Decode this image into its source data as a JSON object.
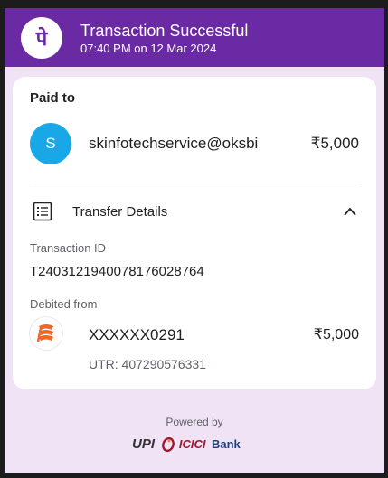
{
  "header": {
    "title": "Transaction Successful",
    "datetime": "07:40 PM on 12 Mar 2024",
    "logo_icon": "phonepe-logo-icon",
    "background": "#6a2aa3"
  },
  "payment": {
    "paid_to_label": "Paid to",
    "avatar_initial": "S",
    "avatar_color": "#18a8e8",
    "payee": "skinfotechservice@oksbi",
    "amount": "₹5,000"
  },
  "transfer_details": {
    "label": "Transfer Details",
    "icon": "list-icon",
    "toggle_icon": "chevron-up-icon",
    "transaction_id_label": "Transaction ID",
    "transaction_id": "T2403121940078176028764",
    "debited_from_label": "Debited from",
    "bank_icon": "bank-of-baroda-icon",
    "account": "XXXXXX0291",
    "amount": "₹5,000",
    "utr": "UTR: 407290576331"
  },
  "footer": {
    "powered_by": "Powered by",
    "upi_label": "UPI",
    "bank_label_1": "ICICI",
    "bank_label_2": "Bank"
  }
}
